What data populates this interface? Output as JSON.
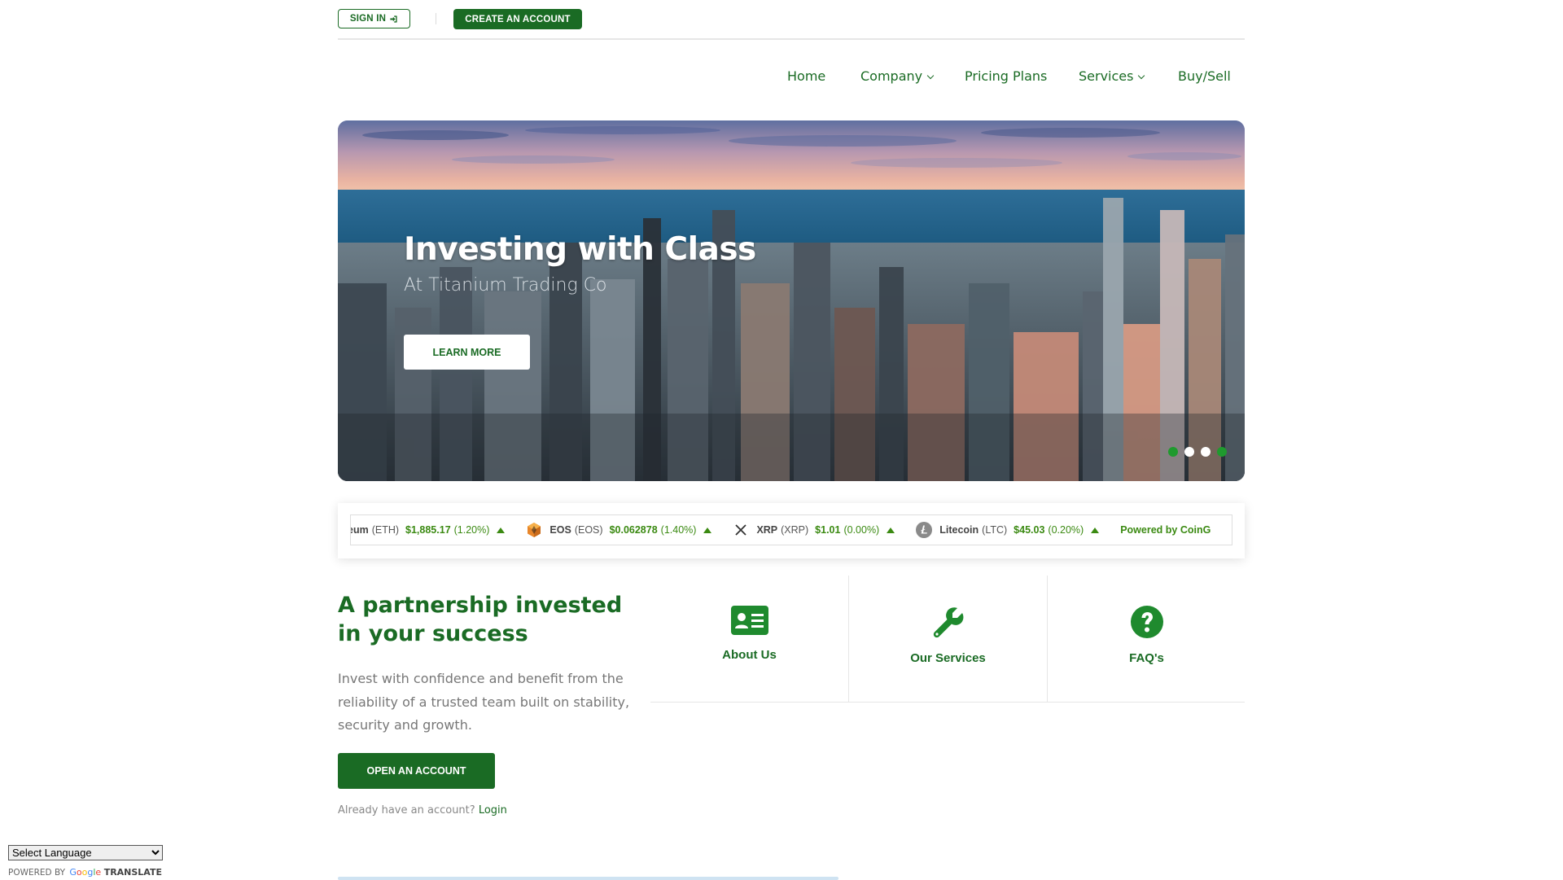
{
  "topbar": {
    "sign_in_label": "SIGN IN",
    "create_account_label": "CREATE AN ACCOUNT"
  },
  "nav": {
    "items": [
      {
        "label": "Home",
        "has_dropdown": false
      },
      {
        "label": "Company",
        "has_dropdown": true
      },
      {
        "label": "Pricing Plans",
        "has_dropdown": false
      },
      {
        "label": "Services",
        "has_dropdown": true
      },
      {
        "label": "Buy/Sell",
        "has_dropdown": false
      }
    ]
  },
  "hero": {
    "title": "Investing with Class",
    "subtitle": "At Titanium Trading Co",
    "button_label": "LEARN MORE",
    "dots": [
      {
        "color": "#1f9a2e",
        "active": true
      },
      {
        "color": "#ffffff",
        "active": false
      },
      {
        "color": "#ffffff",
        "active": false
      },
      {
        "color": "#1f9a2e",
        "active": false
      }
    ]
  },
  "ticker": {
    "coins": [
      {
        "name": "eum",
        "symbol": "(ETH)",
        "price": "$1,885.17",
        "change": "(1.20%)",
        "icon": "none"
      },
      {
        "name": "EOS",
        "symbol": "(EOS)",
        "price": "$0.062878",
        "change": "(1.40%)",
        "icon": "eos-icon"
      },
      {
        "name": "XRP",
        "symbol": "(XRP)",
        "price": "$1.01",
        "change": "(0.00%)",
        "icon": "xrp-icon"
      },
      {
        "name": "Litecoin",
        "symbol": "(LTC)",
        "price": "$45.03",
        "change": "(0.20%)",
        "icon": "litecoin-icon"
      }
    ],
    "powered_prefix": "Powered by ",
    "powered_brand": "CoinG"
  },
  "partnership": {
    "title": "A partnership invested in your success",
    "text": "Invest with confidence and benefit from the reliability of a trusted team built on stability, security and growth.",
    "button_label": "OPEN AN ACCOUNT",
    "already_text": "Already have an account?",
    "login_label": "Login"
  },
  "features": [
    {
      "label": "About Us",
      "icon": "id-card-icon"
    },
    {
      "label": "Our Services",
      "icon": "wrench-icon"
    },
    {
      "label": "FAQ's",
      "icon": "question-circle-icon"
    }
  ],
  "translate": {
    "select_label": "Select Language",
    "powered_by": "POWERED BY",
    "google_letters": [
      "G",
      "o",
      "o",
      "g",
      "l",
      "e"
    ],
    "translate_word": "TRANSLATE"
  },
  "colors": {
    "brand_green": "#1a6b24",
    "price_green": "#3b8a12"
  }
}
